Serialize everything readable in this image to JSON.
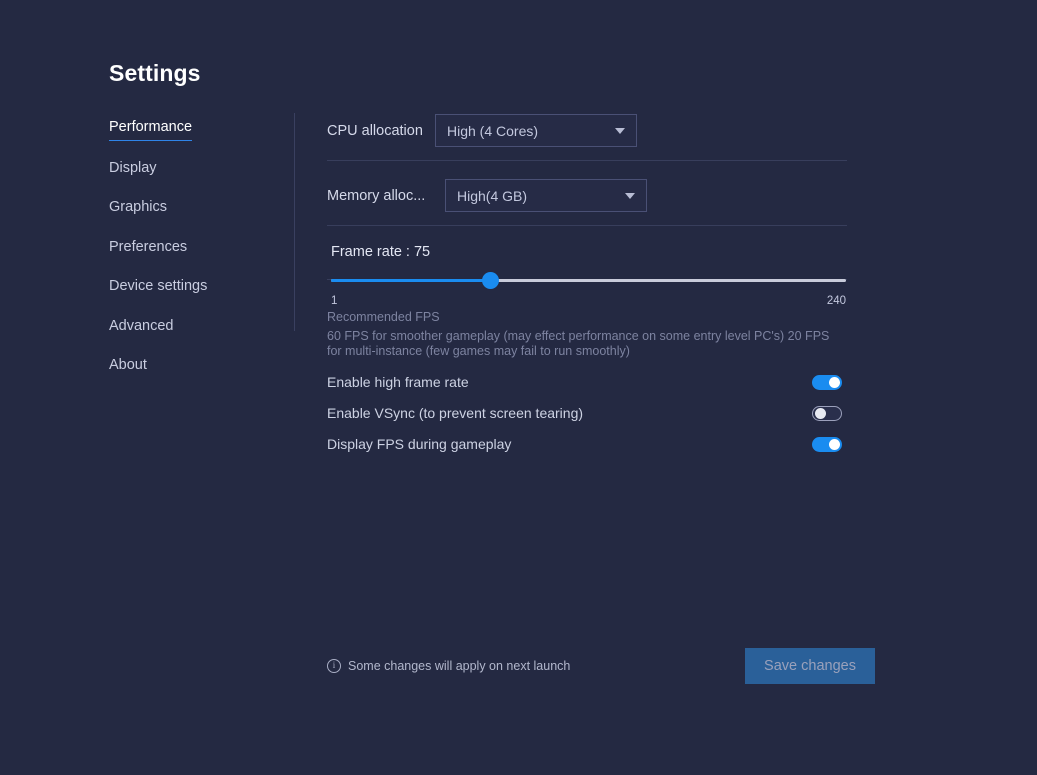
{
  "window": {
    "title": "Settings",
    "background_color": "#242942",
    "accent_color": "#1a8cf0"
  },
  "sidebar": {
    "items": [
      {
        "label": "Performance",
        "active": true
      },
      {
        "label": "Display",
        "active": false
      },
      {
        "label": "Graphics",
        "active": false
      },
      {
        "label": "Preferences",
        "active": false
      },
      {
        "label": "Device settings",
        "active": false
      },
      {
        "label": "Advanced",
        "active": false
      },
      {
        "label": "About",
        "active": false
      }
    ]
  },
  "main": {
    "cpu": {
      "label": "CPU allocation",
      "value": "High (4 Cores)",
      "icon": "chevron-down-icon"
    },
    "memory": {
      "label": "Memory alloc...",
      "value": "High(4 GB)",
      "icon": "chevron-down-icon"
    },
    "frame_rate": {
      "title": "Frame rate : 75",
      "value": 75,
      "min_label": "1",
      "max_label": "240",
      "min": 1,
      "max": 240,
      "fill_percent": "31%"
    },
    "recommended": {
      "heading": "Recommended FPS",
      "body": "60 FPS for smoother gameplay (may effect performance on some entry level PC's) 20 FPS for multi-instance (few games may fail to run smoothly)"
    },
    "toggles": [
      {
        "label": "Enable high frame rate",
        "state": "on"
      },
      {
        "label": "Enable VSync (to prevent screen tearing)",
        "state": "off"
      },
      {
        "label": "Display FPS during gameplay",
        "state": "on"
      }
    ]
  },
  "footer": {
    "info_icon": "info-circle-icon",
    "note": "Some changes will apply on next launch",
    "save_label": "Save changes"
  }
}
